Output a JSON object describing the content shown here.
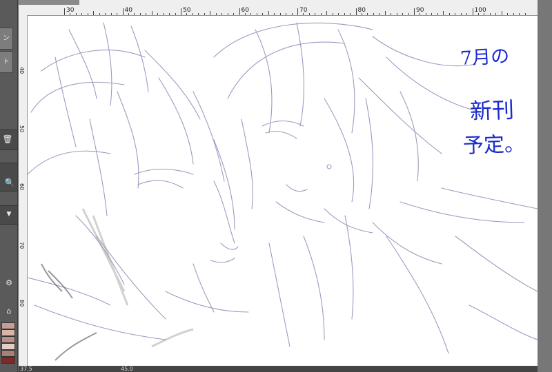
{
  "app": {
    "canvas_tab": "",
    "left_panel": {
      "tab_top_label": "ン",
      "tab_second_label": "ト"
    }
  },
  "ruler": {
    "top_labels": [
      "30",
      "40",
      "50",
      "60",
      "70",
      "80",
      "90",
      "100"
    ],
    "left_labels": [
      "40",
      "50",
      "60",
      "70",
      "80"
    ]
  },
  "status_bar": {
    "zoom": "37.5",
    "angle": "45.0"
  },
  "annotation": {
    "lines": [
      "7月の",
      "新刊",
      "予定。"
    ]
  },
  "colors": {
    "panel_bg": "#5a5a5a",
    "ruler_bg": "#efefef",
    "canvas_bg": "#ffffff",
    "sketch_stroke": "#8a8bb5",
    "annotation_ink": "#1a2bd0"
  }
}
